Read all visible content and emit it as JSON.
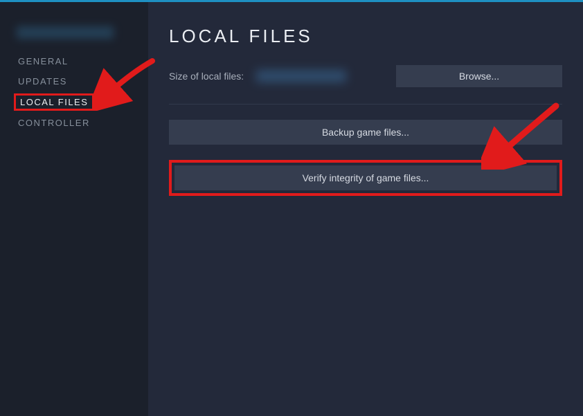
{
  "colors": {
    "highlight": "#e11b1b",
    "accent": "#1e90c2",
    "bg_main": "#23293a",
    "bg_sidebar": "#1b202b",
    "button": "#353d4f"
  },
  "sidebar": {
    "items": [
      {
        "label": "GENERAL"
      },
      {
        "label": "UPDATES"
      },
      {
        "label": "LOCAL FILES"
      },
      {
        "label": "CONTROLLER"
      }
    ]
  },
  "main": {
    "title": "LOCAL FILES",
    "size_label": "Size of local files:",
    "browse_label": "Browse...",
    "backup_label": "Backup game files...",
    "verify_label": "Verify integrity of game files..."
  }
}
